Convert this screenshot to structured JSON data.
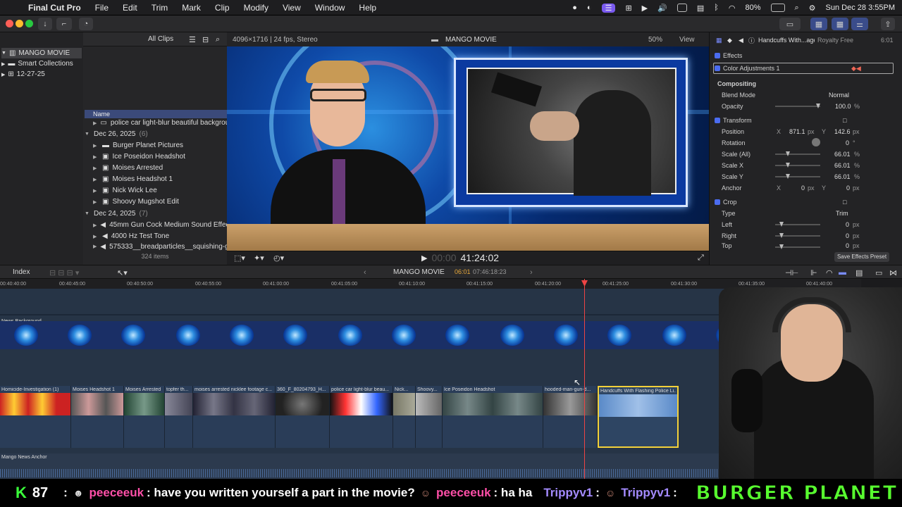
{
  "menubar": {
    "apple": "",
    "app_name": "Final Cut Pro",
    "items": [
      "File",
      "Edit",
      "Trim",
      "Mark",
      "Clip",
      "Modify",
      "View",
      "Window",
      "Help"
    ],
    "battery": "80%",
    "datetime": "Sun Dec 28  3:55PM"
  },
  "browser": {
    "library_name": "MANGO MOVIE",
    "smart_collections": "Smart Collections",
    "event": "12-27-25",
    "all_clips": "All Clips",
    "name_header": "Name",
    "top_item": "police car light-blur beautiful background",
    "group1_date": "Dec 26, 2025",
    "group1_count": "(6)",
    "group1_items": [
      "Burger Planet Pictures",
      "Ice Poseidon Headshot",
      "Moises Arrested",
      "Moises Headshot 1",
      "Nick Wick Lee",
      "Shoovy Mugshot Edit"
    ],
    "group2_date": "Dec 24, 2025",
    "group2_count": "(7)",
    "group2_items": [
      "45mm Gun Cock Medium Sound Effect",
      "4000 Hz Test Tone",
      "575333__breadparticles__squishing-gel"
    ],
    "item_count": "324 items"
  },
  "viewer": {
    "format": "4096×1716 | 24 fps, Stereo",
    "project": "MANGO MOVIE",
    "zoom": "50%",
    "view": "View",
    "timecode_prefix": "00:00",
    "timecode": "41:24:02"
  },
  "inspector": {
    "clip_name": "Handcuffs With...age",
    "license": "Royalty Free",
    "duration": "6:01",
    "effects": "Effects",
    "color_adjust": "Color Adjustments 1",
    "compositing": "Compositing",
    "blend_mode_label": "Blend Mode",
    "blend_mode": "Normal",
    "opacity_label": "Opacity",
    "opacity": "100.0",
    "pct": "%",
    "transform": "Transform",
    "position_label": "Position",
    "pos_x_label": "X",
    "pos_x": "871.1",
    "pos_y_label": "Y",
    "pos_y": "142.6",
    "px": "px",
    "rotation_label": "Rotation",
    "rotation": "0",
    "deg": "°",
    "scale_all_label": "Scale (All)",
    "scale_all": "66.01",
    "scale_x_label": "Scale X",
    "scale_x": "66.01",
    "scale_y_label": "Scale Y",
    "scale_y": "66.01",
    "anchor_label": "Anchor",
    "anchor_x": "0",
    "anchor_y": "0",
    "crop": "Crop",
    "type_label": "Type",
    "type": "Trim",
    "left_label": "Left",
    "left": "0",
    "right_label": "Right",
    "right": "0",
    "top_label": "Top",
    "top": "0",
    "save_preset": "Save Effects Preset"
  },
  "timeline": {
    "index": "Index",
    "project": "MANGO MOVIE",
    "position": "06:01",
    "total": "07:46:18:23",
    "ruler": [
      "00:40:40:00",
      "00:40:45:00",
      "00:40:50:00",
      "00:40:55:00",
      "00:41:00:00",
      "00:41:05:00",
      "00:41:10:00",
      "00:41:15:00",
      "00:41:20:00",
      "00:41:25:00",
      "00:41:30:00",
      "00:41:35:00",
      "00:41:40:00"
    ],
    "bg_track": "News Background",
    "clips": [
      "Homicide-Investigation (1)",
      "Moises Headshot 1",
      "Moises Arrested",
      "topfer th...",
      "moises arrested nicklee footage c...",
      "360_F_80204793_H...",
      "police car light-blur beau...",
      "Nick...",
      "Shoovy...",
      "Ice Poseidon Headshot",
      "hooded-man-gun-d...",
      "Handcuffs With Flashing Police Li..."
    ],
    "anchor_track": "Mango News Anchor"
  },
  "chat": {
    "k_label": "K",
    "k_count": "87",
    "sep": ":",
    "user1": "peeceeuk",
    "msg1": ": have you written yourself a part in the movie?",
    "user2": "peeceeuk",
    "msg2": ": ha ha",
    "user3": "Trippyv1",
    "msg3": ":",
    "user4": "Trippyv1",
    "msg4": ":",
    "banner": "BURGER PLANET"
  }
}
